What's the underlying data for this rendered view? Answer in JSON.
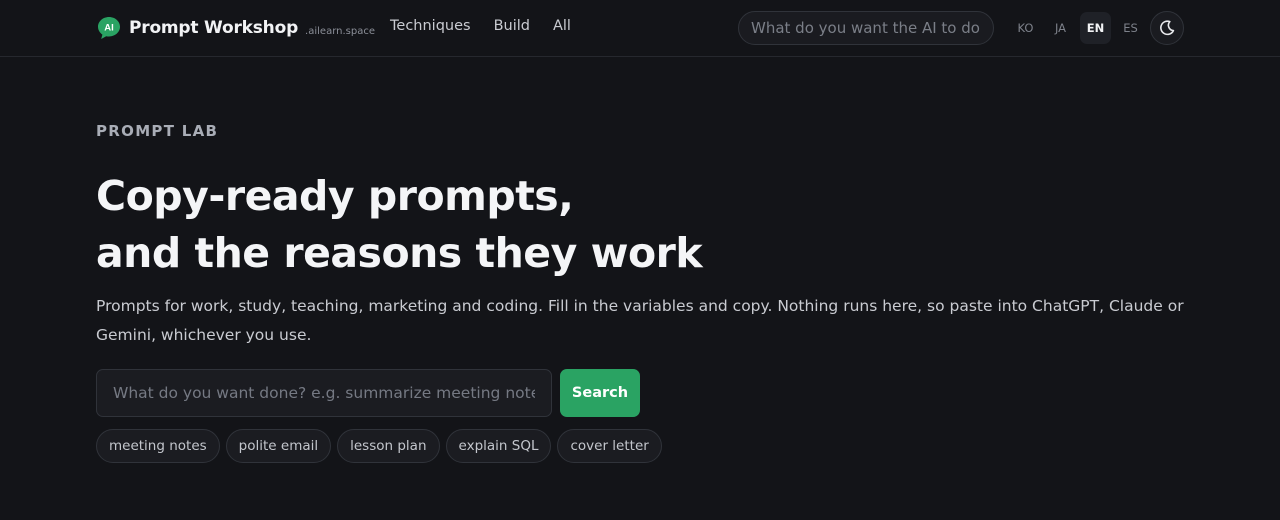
{
  "brand": {
    "logo_icon": "ai-speech-bubble-icon",
    "logo_text": "AI",
    "name": "Prompt Workshop",
    "domain": ".ailearn.space",
    "accent": "#2aa363"
  },
  "nav": [
    "Techniques",
    "Build",
    "All"
  ],
  "header_search": {
    "placeholder": "What do you want the AI to do?"
  },
  "languages": [
    {
      "code": "KO",
      "active": false
    },
    {
      "code": "JA",
      "active": false
    },
    {
      "code": "EN",
      "active": true
    },
    {
      "code": "ES",
      "active": false
    }
  ],
  "theme_toggle": {
    "icon": "moon-icon"
  },
  "hero": {
    "eyebrow": "PROMPT LAB",
    "headline_line1": "Copy-ready prompts,",
    "headline_line2": "and the reasons they work",
    "description": "Prompts for work, study, teaching, marketing and coding. Fill in the variables and copy. Nothing runs here, so paste into ChatGPT, Claude or Gemini, whichever you use.",
    "search_placeholder": "What do you want done? e.g. summarize meeting notes",
    "search_button": "Search",
    "suggestions": [
      "meeting notes",
      "polite email",
      "lesson plan",
      "explain SQL",
      "cover letter"
    ]
  }
}
